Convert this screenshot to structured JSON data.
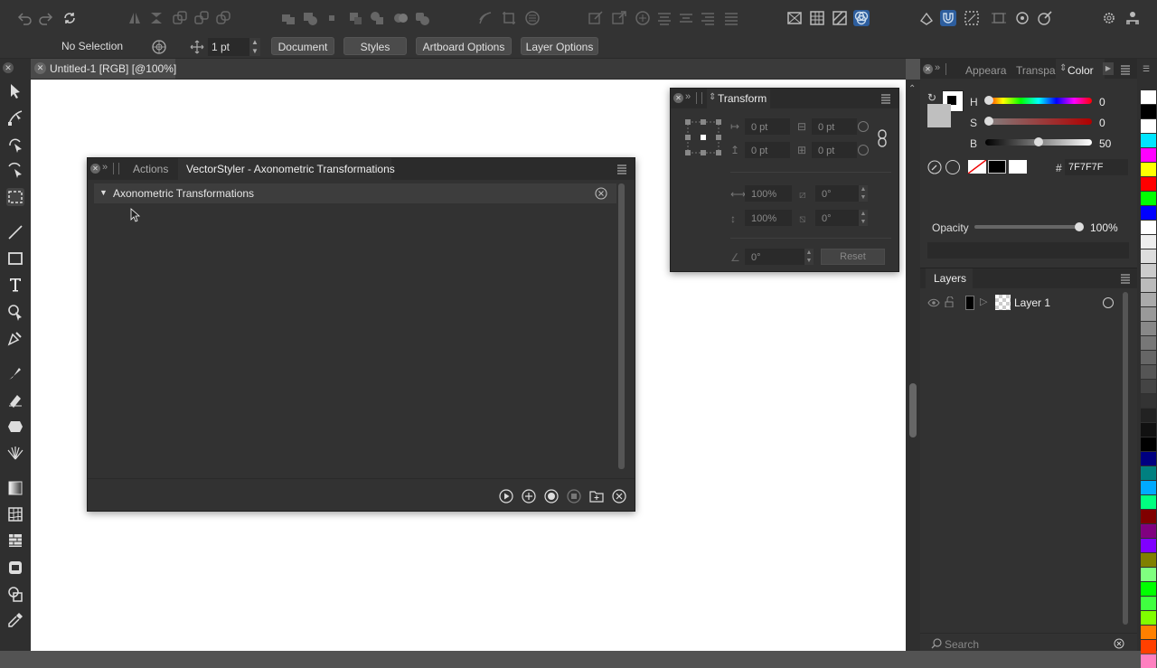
{
  "control_bar": {
    "selection": "No Selection",
    "stroke_weight": "1 pt",
    "buttons": [
      "Document",
      "Styles",
      "Artboard Options",
      "Layer Options"
    ]
  },
  "document_tab": {
    "title": "Untitled-1 [RGB] [@100%]"
  },
  "actions_panel": {
    "tabs": [
      "Actions",
      "VectorStyler - Axonometric Transformations"
    ],
    "set_name": "Axonometric Transformations"
  },
  "transform_panel": {
    "title": "Transform",
    "x": "0 pt",
    "y": "0 pt",
    "w": "0 pt",
    "h": "0 pt",
    "scale_x": "100%",
    "scale_y": "100%",
    "skew_x": "0°",
    "skew_y": "0°",
    "rotate": "0°",
    "reset_label": "Reset"
  },
  "color_panel": {
    "tabs": [
      "Appeara",
      "Transpa",
      "Color"
    ],
    "h_label": "H",
    "h_value": "0",
    "s_label": "S",
    "s_value": "0",
    "b_label": "B",
    "b_value": "50",
    "hex_label": "#",
    "hex_value": "7F7F7F",
    "opacity_label": "Opacity",
    "opacity_value": "100%",
    "opacity_fraction": 1.0,
    "brightness_fraction": 0.5
  },
  "layers_panel": {
    "title": "Layers",
    "layers": [
      {
        "name": "Layer 1"
      }
    ],
    "search_placeholder": "Search"
  },
  "colors": {
    "accent": "#3b7bd6",
    "panel_bg": "#323232",
    "canvas": "#ffffff"
  },
  "swatches": [
    "#ffffff",
    "#000000",
    "#ffffff",
    "#00e5ff",
    "#ff00ff",
    "#ffff00",
    "#ff0000",
    "#00ff00",
    "#0000ff",
    "#ffffff",
    "#eeeeee",
    "#dddddd",
    "#cccccc",
    "#bbbbbb",
    "#aaaaaa",
    "#999999",
    "#888888",
    "#777777",
    "#666666",
    "#555555",
    "#444444",
    "#333333",
    "#222222",
    "#111111",
    "#000000",
    "#000080",
    "#008080",
    "#00aaff",
    "#00ff80",
    "#800000",
    "#800080",
    "#8000ff",
    "#808000",
    "#80ff80",
    "#00ff00",
    "#40ff40",
    "#80ff00",
    "#ff8000",
    "#ff4000",
    "#ff80c0"
  ]
}
